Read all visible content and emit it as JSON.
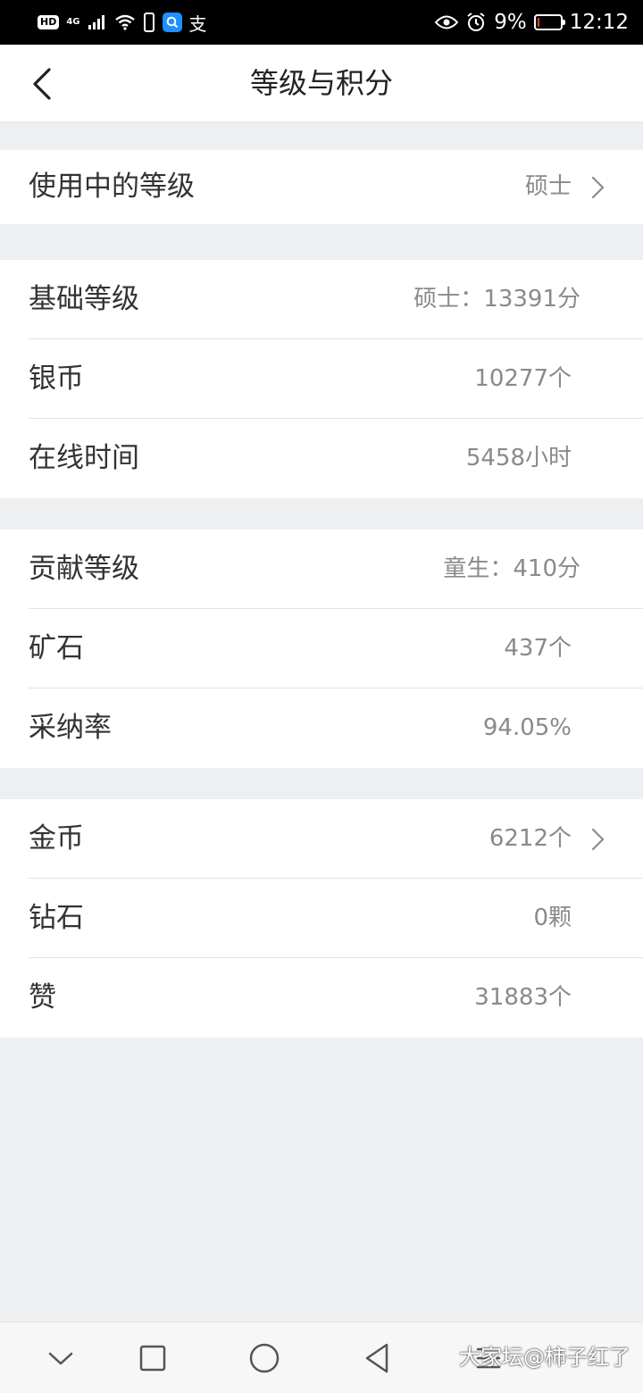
{
  "status_bar": {
    "hd": "HD",
    "network": "4G",
    "alipay_glyph": "支",
    "battery_text": "9%",
    "time": "12:12",
    "battery_level": 0.09,
    "battery_color": "#ff3b30",
    "icons": [
      "wifi-icon",
      "phone-icon",
      "search-app-icon",
      "alipay-icon",
      "eye-icon",
      "alarm-icon",
      "battery-icon"
    ]
  },
  "header": {
    "title": "等级与积分",
    "back_icon": "chevron-left-icon"
  },
  "section_current": {
    "label": "使用中的等级",
    "value": "硕士"
  },
  "section_basic": {
    "rows": [
      {
        "label": "基础等级",
        "value": "硕士：13391分"
      },
      {
        "label": "银币",
        "value": "10277个"
      },
      {
        "label": "在线时间",
        "value": "5458小时"
      }
    ]
  },
  "section_contrib": {
    "rows": [
      {
        "label": "贡献等级",
        "value": "童生：410分"
      },
      {
        "label": "矿石",
        "value": "437个"
      },
      {
        "label": "采纳率",
        "value": "94.05%"
      }
    ]
  },
  "section_assets": {
    "rows": [
      {
        "label": "金币",
        "value": "6212个"
      },
      {
        "label": "钻石",
        "value": "0颗"
      },
      {
        "label": "赞",
        "value": "31883个"
      }
    ]
  },
  "system_nav": {
    "icons": [
      "collapse-icon",
      "recents-icon",
      "home-icon",
      "back-icon",
      "menu-icon"
    ]
  },
  "watermark": "大家坛@柿子红了",
  "colors": {
    "background": "#eeeff1",
    "card": "#ffffff",
    "label": "#333333",
    "value": "#8a8a8a"
  }
}
